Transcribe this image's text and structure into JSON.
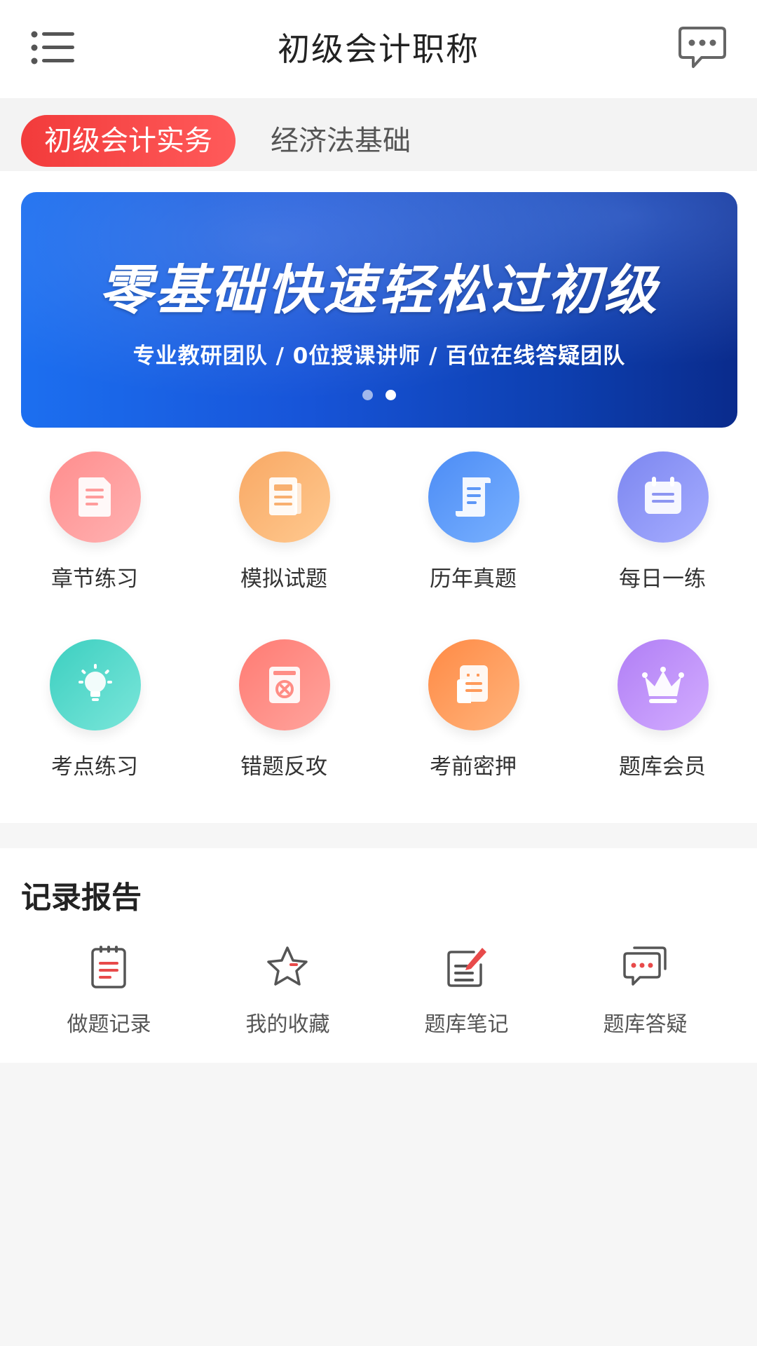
{
  "header": {
    "title": "初级会计职称",
    "menu_icon": "list-menu-icon",
    "chat_icon": "chat-bubble-icon"
  },
  "tabs": [
    {
      "label": "初级会计实务",
      "active": true
    },
    {
      "label": "经济法基础",
      "active": false
    }
  ],
  "banner": {
    "title": "零基础快速轻松过初级",
    "subtitle": "专业教研团队 /   0位授课讲师   /   百位在线答疑团队",
    "dots": 2,
    "active_dot": 1
  },
  "grid": [
    {
      "label": "章节练习",
      "icon": "document-icon",
      "color_from": "#ff8d8d",
      "color_to": "#ffb2b2"
    },
    {
      "label": "模拟试题",
      "icon": "paper-icon",
      "color_from": "#f8a864",
      "color_to": "#ffc98f"
    },
    {
      "label": "历年真题",
      "icon": "scroll-icon",
      "color_from": "#4c8cf5",
      "color_to": "#79b1ff"
    },
    {
      "label": "每日一练",
      "icon": "calendar-icon",
      "color_from": "#7c86f0",
      "color_to": "#a6adff"
    },
    {
      "label": "考点练习",
      "icon": "lightbulb-icon",
      "color_from": "#3ccfc0",
      "color_to": "#7be6da"
    },
    {
      "label": "错题反攻",
      "icon": "error-book-icon",
      "color_from": "#ff7b73",
      "color_to": "#ffa49d"
    },
    {
      "label": "考前密押",
      "icon": "note-icon",
      "color_from": "#ff8a45",
      "color_to": "#ffb47c"
    },
    {
      "label": "题库会员",
      "icon": "crown-icon",
      "color_from": "#b07ef5",
      "color_to": "#d3adff"
    }
  ],
  "records": {
    "title": "记录报告",
    "items": [
      {
        "label": "做题记录",
        "icon": "clipboard-icon"
      },
      {
        "label": "我的收藏",
        "icon": "star-icon"
      },
      {
        "label": "题库笔记",
        "icon": "edit-note-icon"
      },
      {
        "label": "题库答疑",
        "icon": "qa-bubble-icon"
      }
    ]
  },
  "colors": {
    "accent": "#f23b3b",
    "text_dark": "#222222",
    "text_muted": "#555555"
  }
}
